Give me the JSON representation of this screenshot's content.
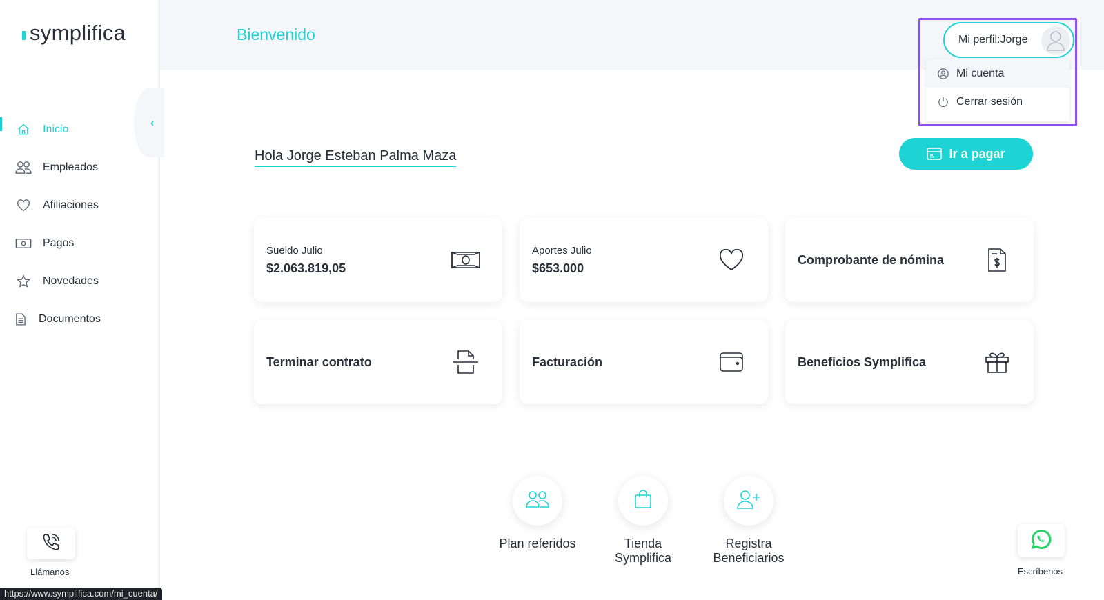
{
  "brand": {
    "name": "symplifica",
    "accent": "#1dd3d3",
    "highlight": "#8b50f0"
  },
  "sidebar": {
    "collapse_icon": "chevron-left-icon",
    "items": [
      {
        "label": "Inicio",
        "icon": "home-icon",
        "active": true
      },
      {
        "label": "Empleados",
        "icon": "users-icon"
      },
      {
        "label": "Afiliaciones",
        "icon": "heart-icon"
      },
      {
        "label": "Pagos",
        "icon": "money-icon"
      },
      {
        "label": "Novedades",
        "icon": "star-icon"
      },
      {
        "label": "Documentos",
        "icon": "document-icon"
      }
    ],
    "call_label": "Llámanos"
  },
  "status_bar": {
    "url": "https://www.symplifica.com/mi_cuenta/"
  },
  "header": {
    "title": "Bienvenido"
  },
  "profile": {
    "label": "Mi perfil:Jorge",
    "menu": [
      {
        "label": "Mi cuenta",
        "icon": "user-circle-icon"
      },
      {
        "label": "Cerrar sesión",
        "icon": "power-icon"
      }
    ]
  },
  "main": {
    "greeting": "Hola Jorge Esteban Palma Maza",
    "pay_button": "Ir a pagar",
    "cards": [
      {
        "label": "Sueldo Julio",
        "value": "$2.063.819,05",
        "icon": "money-icon"
      },
      {
        "label": "Aportes Julio",
        "value": "$653.000",
        "icon": "heart-icon"
      },
      {
        "title": "Comprobante de nómina",
        "icon": "receipt-icon"
      },
      {
        "title": "Terminar contrato",
        "icon": "cut-document-icon"
      },
      {
        "title": "Facturación",
        "icon": "wallet-icon"
      },
      {
        "title": "Beneficios Symplifica",
        "icon": "gift-icon"
      }
    ],
    "quick_links": [
      {
        "label": "Plan referidos",
        "icon": "users-icon"
      },
      {
        "label": "Tienda Symplifica",
        "icon": "shopping-bag-icon"
      },
      {
        "label": "Registra Beneficiarios",
        "icon": "user-plus-icon"
      }
    ],
    "whatsapp_label": "Escríbenos"
  }
}
